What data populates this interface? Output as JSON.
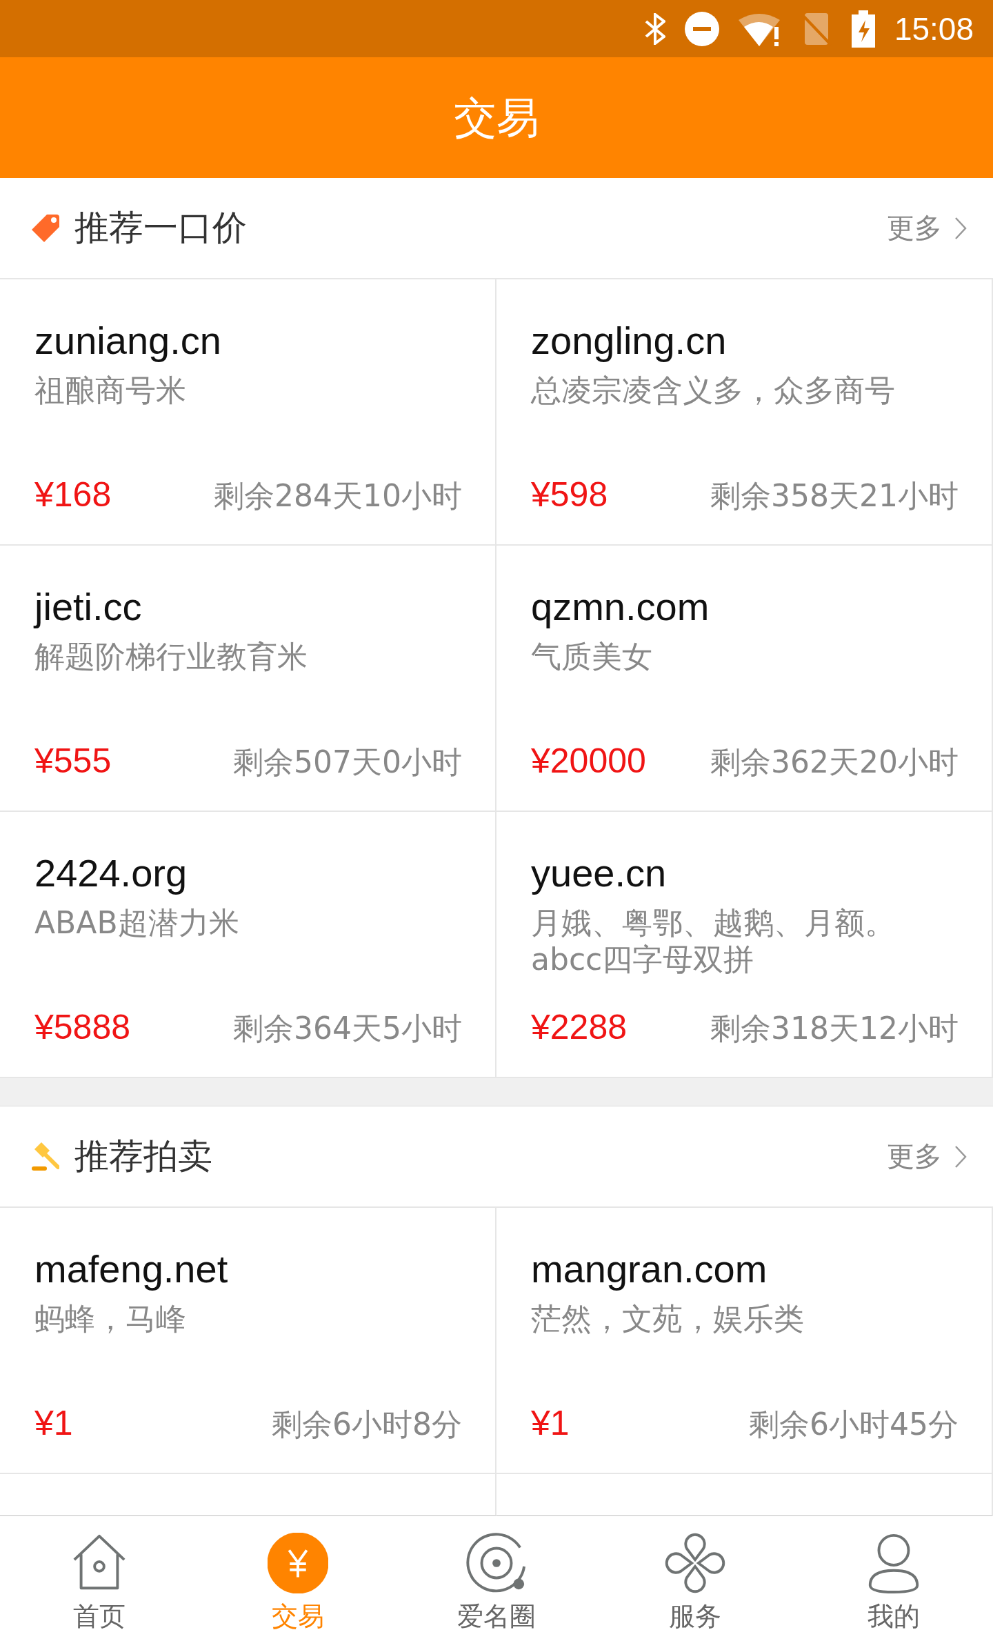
{
  "status_bar": {
    "time": "15:08"
  },
  "header": {
    "title": "交易"
  },
  "sections": [
    {
      "kind": "fixed",
      "title": "推荐一口价",
      "more": "更多",
      "items": [
        {
          "domain": "zuniang.cn",
          "description": "祖酿商号米",
          "price": "¥168",
          "remaining": "剩余284天10小时"
        },
        {
          "domain": "zongling.cn",
          "description": "总凌宗凌含义多，众多商号",
          "price": "¥598",
          "remaining": "剩余358天21小时"
        },
        {
          "domain": "jieti.cc",
          "description": "解题阶梯行业教育米",
          "price": "¥555",
          "remaining": "剩余507天0小时"
        },
        {
          "domain": "qzmn.com",
          "description": "气质美女",
          "price": "¥20000",
          "remaining": "剩余362天20小时"
        },
        {
          "domain": "2424.org",
          "description": "ABAB超潜力米",
          "price": "¥5888",
          "remaining": "剩余364天5小时"
        },
        {
          "domain": "yuee.cn",
          "description": "月娥、粤鄂、越鹅、月额。abcc四字母双拼",
          "price": "¥2288",
          "remaining": "剩余318天12小时"
        }
      ]
    },
    {
      "kind": "auction",
      "title": "推荐拍卖",
      "more": "更多",
      "items": [
        {
          "domain": "mafeng.net",
          "description": "蚂蜂，马峰",
          "price": "¥1",
          "remaining": "剩余6小时8分"
        },
        {
          "domain": "mangran.com",
          "description": "茫然，文苑，娱乐类",
          "price": "¥1",
          "remaining": "剩余6小时45分"
        }
      ]
    }
  ],
  "tab_bar": [
    {
      "label": "首页",
      "selected": false
    },
    {
      "label": "交易",
      "selected": true
    },
    {
      "label": "爱名圈",
      "selected": false
    },
    {
      "label": "服务",
      "selected": false
    },
    {
      "label": "我的",
      "selected": false
    }
  ]
}
